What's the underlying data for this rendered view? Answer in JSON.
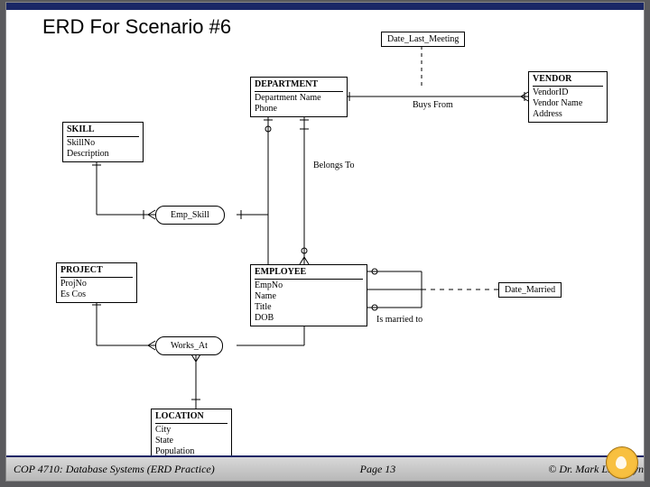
{
  "title": "ERD For Scenario #6",
  "entities": {
    "skill": {
      "name": "SKILL",
      "attrs": "SkillNo\nDescription"
    },
    "department": {
      "name": "DEPARTMENT",
      "attrs": "Department Name\nPhone"
    },
    "vendor": {
      "name": "VENDOR",
      "attrs": "VendorID\nVendor Name\nAddress"
    },
    "project": {
      "name": "PROJECT",
      "attrs": "ProjNo\nEs Cos"
    },
    "employee": {
      "name": "EMPLOYEE",
      "attrs": "EmpNo\nName\nTitle\nDOB"
    },
    "location": {
      "name": "LOCATION",
      "attrs": "City\nState\nPopulation"
    }
  },
  "assoc": {
    "emp_skill": "Emp_Skill",
    "works_at": "Works_At"
  },
  "derived": {
    "date_last_meeting": "Date_Last_Meeting",
    "date_married": "Date_Married"
  },
  "rels": {
    "buys_from": "Buys From",
    "belongs_to": "Belongs To",
    "is_married_to": "Is married to"
  },
  "footer": {
    "left": "COP 4710: Database Systems  (ERD Practice)",
    "center": "Page 13",
    "right": "© Dr. Mark Llewellyn"
  }
}
